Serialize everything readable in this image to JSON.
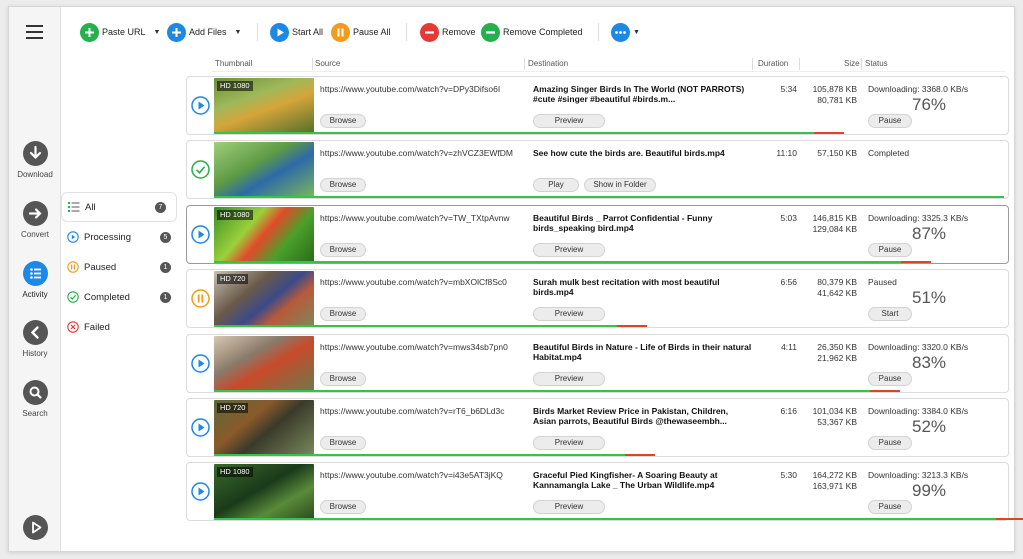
{
  "toolbar": {
    "paste_url": "Paste URL",
    "add_files": "Add Files",
    "start_all": "Start All",
    "pause_all": "Pause All",
    "remove": "Remove",
    "remove_completed": "Remove Completed"
  },
  "nav": {
    "download": "Download",
    "convert": "Convert",
    "activity": "Activity",
    "history": "History",
    "search": "Search"
  },
  "filters": [
    {
      "label": "All",
      "count": "7"
    },
    {
      "label": "Processing",
      "count": "5"
    },
    {
      "label": "Paused",
      "count": "1"
    },
    {
      "label": "Completed",
      "count": "1"
    },
    {
      "label": "Failed",
      "count": ""
    }
  ],
  "columns": {
    "thumbnail": "Thumbnail",
    "source": "Source",
    "destination": "Destination",
    "duration": "Duration",
    "size": "Size",
    "status": "Status"
  },
  "buttons": {
    "browse": "Browse",
    "preview": "Preview",
    "play": "Play",
    "show_in_folder": "Show in Folder",
    "pause": "Pause",
    "start": "Start"
  },
  "rows": [
    {
      "quality": "HD 1080",
      "source": "https://www.youtube.com/watch?v=DPy3Difso6I",
      "destination": "Amazing Singer Birds In The  World (NOT PARROTS) #cute #singer #beautiful #birds.m...",
      "duration": "5:34",
      "size_total": "105,878 KB",
      "size_done": "80,781 KB",
      "status": "Downloading: 3368.0 KB/s",
      "percent": "76%",
      "progress": 0.76,
      "state": "downloading"
    },
    {
      "quality": "",
      "source": "https://www.youtube.com/watch?v=zhVCZ3EWfDM",
      "destination": "See how cute the birds are. Beautiful birds.mp4",
      "duration": "11:10",
      "size_total": "57,150 KB",
      "size_done": "",
      "status": "Completed",
      "percent": "",
      "progress": 1.0,
      "state": "completed"
    },
    {
      "quality": "HD 1080",
      "source": "https://www.youtube.com/watch?v=TW_TXtpAvnw",
      "destination": "Beautiful Birds _ Parrot Confidential - Funny birds_speaking bird.mp4",
      "duration": "5:03",
      "size_total": "146,815 KB",
      "size_done": "129,084 KB",
      "status": "Downloading: 3325.3 KB/s",
      "percent": "87%",
      "progress": 0.87,
      "state": "downloading"
    },
    {
      "quality": "HD 720",
      "source": "https://www.youtube.com/watch?v=mbXOlCf8Sc0",
      "destination": "Surah mulk best recitation with most   beautiful birds.mp4",
      "duration": "6:56",
      "size_total": "80,379 KB",
      "size_done": "41,642 KB",
      "status": "Paused",
      "percent": "51%",
      "progress": 0.51,
      "state": "paused"
    },
    {
      "quality": "",
      "source": "https://www.youtube.com/watch?v=mws34sb7pn0",
      "destination": "Beautiful Birds in Nature - Life of Birds in their natural Habitat.mp4",
      "duration": "4:11",
      "size_total": "26,350 KB",
      "size_done": "21,962 KB",
      "status": "Downloading: 3320.0 KB/s",
      "percent": "83%",
      "progress": 0.83,
      "state": "downloading"
    },
    {
      "quality": "HD 720",
      "source": "https://www.youtube.com/watch?v=rT6_b6DLd3c",
      "destination": "Birds Market Review Price in Pakistan, Children, Asian parrots, Beautiful Birds @thewaseembh...",
      "duration": "6:16",
      "size_total": "101,034 KB",
      "size_done": "53,367 KB",
      "status": "Downloading: 3384.0 KB/s",
      "percent": "52%",
      "progress": 0.52,
      "state": "downloading"
    },
    {
      "quality": "HD 1080",
      "source": "https://www.youtube.com/watch?v=i43e5AT3jKQ",
      "destination": "Graceful Pied Kingfisher- A Soaring Beauty at Kannamangla Lake _ The Urban Wildlife.mp4",
      "duration": "5:30",
      "size_total": "164,272 KB",
      "size_done": "163,971 KB",
      "status": "Downloading: 3213.3 KB/s",
      "percent": "99%",
      "progress": 0.99,
      "state": "downloading"
    }
  ],
  "colors": {
    "accent": "#1e88e5",
    "green": "#22b14c",
    "orange": "#f39c1c",
    "red": "#e53935"
  }
}
